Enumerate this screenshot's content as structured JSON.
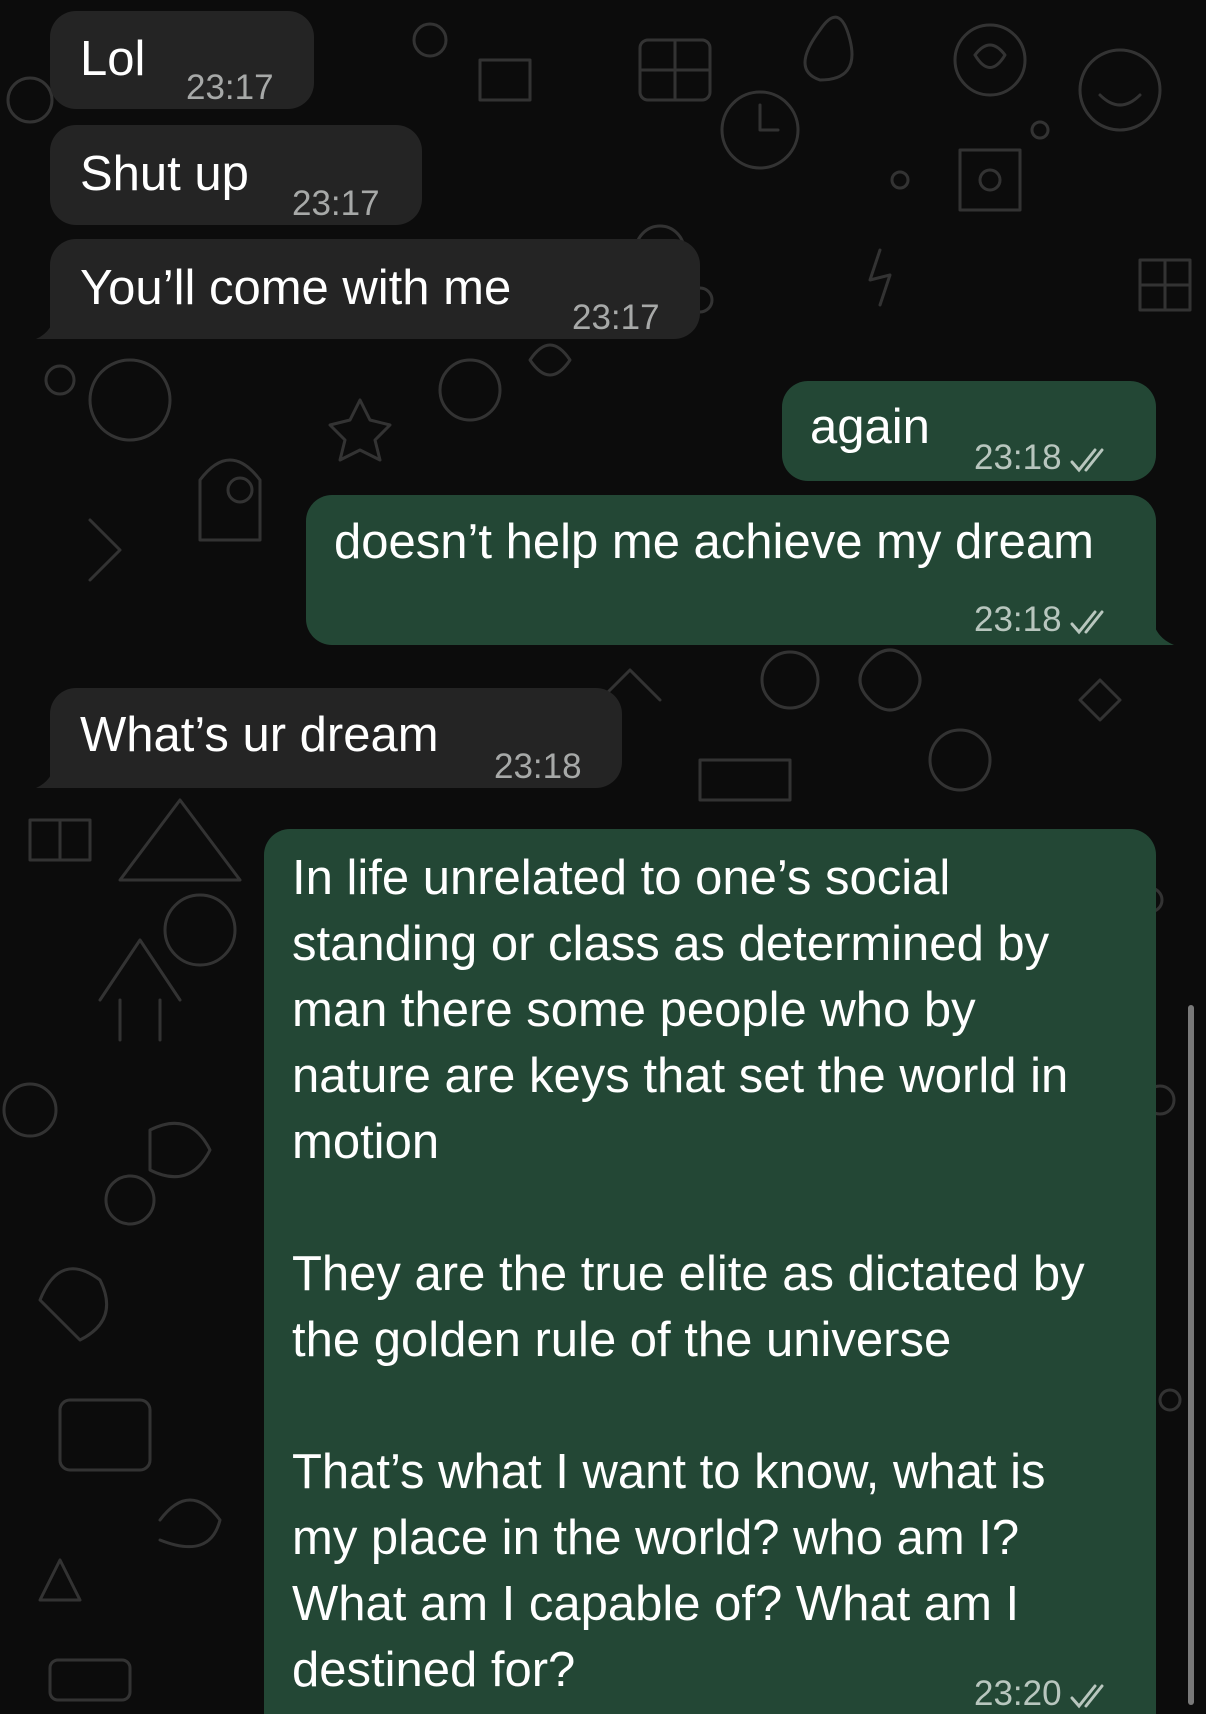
{
  "messages": [
    {
      "id": 1,
      "direction": "incoming",
      "text": "Lol",
      "time": "23:17"
    },
    {
      "id": 2,
      "direction": "incoming",
      "text": "Shut up",
      "time": "23:17"
    },
    {
      "id": 3,
      "direction": "incoming",
      "text": "You’ll come with me",
      "time": "23:17"
    },
    {
      "id": 4,
      "direction": "outgoing",
      "text": "again",
      "time": "23:18",
      "status": "read-double-check"
    },
    {
      "id": 5,
      "direction": "outgoing",
      "text": "doesn’t help me achieve my dream",
      "time": "23:18",
      "status": "read-double-check"
    },
    {
      "id": 6,
      "direction": "incoming",
      "text": "What’s ur dream",
      "time": "23:18"
    },
    {
      "id": 7,
      "direction": "outgoing",
      "paragraphs": [
        "In life unrelated to one’s social\nstanding or class as determined by\nman there some people who by\nnature are keys that set the world in\nmotion",
        "They are the true elite as dictated by\nthe golden rule of the universe",
        "That’s what I want to know, what is\nmy place in the world? who am I?\nWhat am I capable of? What am I\ndestined for?"
      ],
      "time": "23:20",
      "status": "read-double-check"
    }
  ],
  "colors": {
    "background": "#0c0c0c",
    "incoming_bubble": "#242424",
    "outgoing_bubble": "#234735",
    "timestamp": "#a7a9a8"
  },
  "icons": [
    "double-check-icon",
    "doodle-wallpaper"
  ]
}
